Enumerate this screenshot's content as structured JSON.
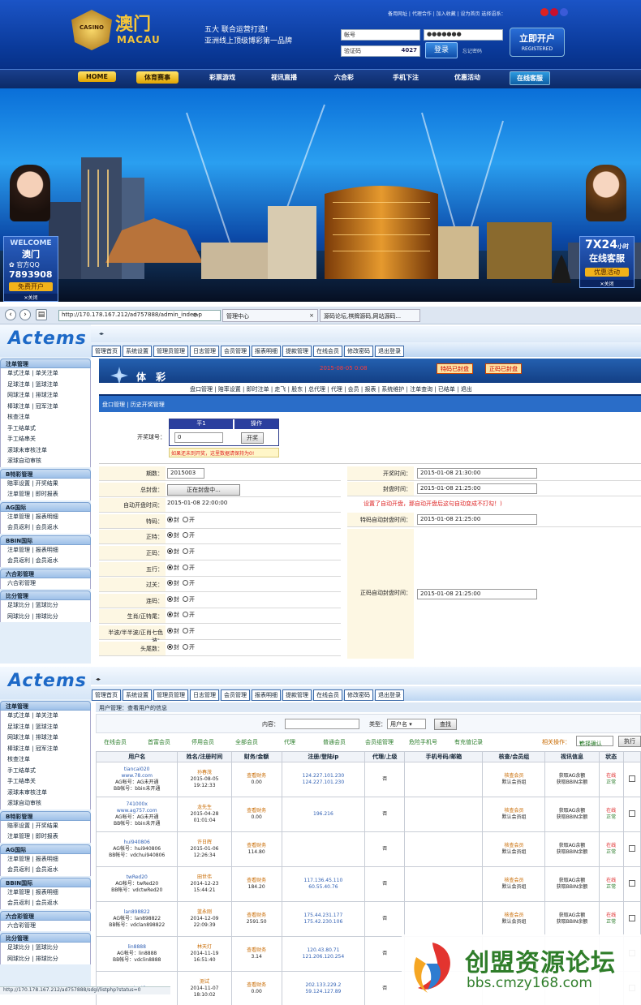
{
  "site": {
    "logo_cn": "澳门",
    "logo_en": "MACAU",
    "crest_text": "CASINO",
    "slogan_line1": "五大  联合运营打造!",
    "slogan_line2": "亚洲线上顶级博彩第一品牌",
    "top_links": "备用网址 | 代理合作 | 加入收藏 | 设为首页  选择语系：",
    "account_label": "帐号",
    "password_label": "密码",
    "password_value": "●●●●●●●",
    "captcha_label": "验证码",
    "captcha_value": "4027",
    "login_button": "登录",
    "forgot": "忘记密码",
    "register_main": "立即开户",
    "register_sub": "REGISTERED",
    "nav": [
      "HOME",
      "体育赛事",
      "彩票游戏",
      "视讯直播",
      "六合彩",
      "手机下注",
      "优惠活动",
      "在线客服"
    ],
    "welcome": {
      "title": "WELCOME",
      "name": "澳门",
      "qq_label": "官方QQ",
      "qq": "7893908",
      "cta": "免费开户",
      "close": "关闭"
    },
    "service": {
      "big": "7X24",
      "small": "小时",
      "label": "在线客服",
      "cta": "优惠活动",
      "close": "关闭"
    }
  },
  "browser": {
    "url": "http://170.178.167.212/ad757888/admin_index.p",
    "tab1": "管理中心",
    "tab2": "源码论坛,棋牌源码,网站源码..."
  },
  "admin": {
    "logo": "Actems",
    "top_nav": [
      "管理首页",
      "系统设置",
      "管理员管理",
      "日志管理",
      "会员管理",
      "报表明细",
      "提款管理",
      "在线会员",
      "修改密码",
      "退出登录"
    ],
    "sidebar_groups": [
      {
        "title": "注单管理",
        "links": [
          "单式注单 | 单关注单",
          "足球注单 | 篮球注单",
          "网球注单 | 排球注单",
          "棒球注单 | 冠军注单",
          "核查注单",
          "手工结单式",
          "手工结串关",
          "滚球未审核注单",
          "滚球自动审核"
        ]
      },
      {
        "title": "B特彩管理",
        "links": [
          "赔率设置 | 开奖结果",
          "注单管理 | 即时报表"
        ]
      },
      {
        "title": "AG国际",
        "links": [
          "注单管理 | 报表明细",
          "会员返利 | 会员返水"
        ]
      },
      {
        "title": "BBIN国际",
        "links": [
          "注单管理 | 报表明细",
          "会员返利 | 会员返水"
        ]
      },
      {
        "title": "六合彩管理",
        "links": [
          "六合彩管理"
        ]
      },
      {
        "title": "比分管理",
        "links": [
          "足球比分 | 篮球比分",
          "网球比分 | 排球比分"
        ]
      }
    ],
    "lottery_title": "体 彩",
    "server_time": "2015-08-05 0:08",
    "btn_special_closed": "特码已封盘",
    "btn_main_closed": "正码已封盘",
    "submenu": "盘口管理 | 赔率设置 | 即时注单 | 走飞 | 股东 | 总代理 | 代理 | 会员 | 报表 | 系统维护 | 注单查询 | 已结单 | 退出",
    "breadcrumb": "盘口管理  |  历史开奖管理",
    "draw_label": "开奖球号：",
    "draw_col1": "平1",
    "draw_col2": "操作",
    "draw_value": "0",
    "draw_button": "开奖",
    "draw_warning": "如果还未到开奖，这里数据请保持为0!",
    "issue_label": "期数：",
    "issue_value": "2015003",
    "draw_time_label": "开奖时间：",
    "draw_time_value": "2015-01-08 21:30:00",
    "total_close_label": "总封盘：",
    "total_close_btn": "正在封盘中...",
    "close_time_label": "封盘时间：",
    "close_time_value": "2015-01-08 21:25:00",
    "auto_open_label": "自动开盘时间：",
    "auto_open_value": "2015-01-08 22:00:00",
    "auto_note": "设置了自动开盘，那自动开盘后这句自动变成不打勾！)",
    "special_auto_label": "特码自动封盘时间：",
    "special_auto_value": "2015-01-08 21:25:00",
    "main_auto_label": "正码自动封盘时间：",
    "main_auto_value": "2015-01-08 21:25:00",
    "opt_close": "封",
    "opt_open": "开",
    "toggles": [
      "特码：",
      "正特：",
      "正码：",
      "五行：",
      "过关：",
      "连码：",
      "生肖/正特尾：",
      "半波/半半波/正肖七色波：",
      "头尾数："
    ]
  },
  "users": {
    "breadcrumb": "用户管理：查看用户的信息",
    "content_label": "内容：",
    "type_label": "类型：",
    "type_value": "用户名",
    "search_btn": "查找",
    "filters": [
      "在线会员",
      "首富会员",
      "停用会员",
      "全部会员",
      "代理",
      "普通会员",
      "会员组管理",
      "危险手机号",
      "有充值记录"
    ],
    "batch_label": "相关操作：",
    "batch_value": "选择确认",
    "exec_btn": "执行",
    "headers": [
      "用户名",
      "姓名/注册时间",
      "财务/金额",
      "注册/登陆ip",
      "代理/上级",
      "手机号码/邮箱",
      "核查/会员组",
      "视讯信息",
      "状态",
      ""
    ],
    "rows": [
      {
        "user": "tiancai020",
        "site": "www.78.com",
        "ag": "AG帐号：AG未开通",
        "bb": "BB帐号：bbin未开通",
        "name": "孙春茂",
        "date": "2015-08-05",
        "time": "19:12:33",
        "fin": "查看财务",
        "amt": "0.00",
        "ip1": "124.227.101.230",
        "ip2": "124.227.101.230",
        "agent": "否",
        "check": "核查会员",
        "group": "默认会员组",
        "v1": "获取AG余额",
        "v2": "获取BBIN余额",
        "online": "在线",
        "state": "正常"
      },
      {
        "user": "741000x",
        "site": "www.ag757.com",
        "ag": "AG帐号：AG未开通",
        "bb": "BB帐号：bbin未开通",
        "name": "龙先生",
        "date": "2015-04-28",
        "time": "01:01:04",
        "fin": "查看财务",
        "amt": "0.00",
        "ip1": "196.216",
        "ip2": "",
        "agent": "否",
        "check": "核查会员",
        "group": "默认会员组",
        "v1": "获取AG余额",
        "v2": "获取BBIN余额",
        "online": "在线",
        "state": "正常"
      },
      {
        "user": "hui940806",
        "site": "",
        "ag": "AG帐号：hui940806",
        "bb": "BB帐号：vdchui940806",
        "name": "许日辉",
        "date": "2015-01-06",
        "time": "12:26:34",
        "fin": "查看财务",
        "amt": "114.80",
        "ip1": "",
        "ip2": "",
        "agent": "否",
        "check": "核查会员",
        "group": "默认会员组",
        "v1": "获取AG余额",
        "v2": "获取BBIN余额",
        "online": "在线",
        "state": "正常"
      },
      {
        "user": "twRed20",
        "site": "",
        "ag": "AG帐号：twRed20",
        "bb": "BB帐号：vdctwRed20",
        "name": "田世伟",
        "date": "2014-12-23",
        "time": "15:44:21",
        "fin": "查看财务",
        "amt": "184.20",
        "ip1": "117.136.45.110",
        "ip2": "60.55.40.76",
        "agent": "否",
        "check": "核查会员",
        "group": "默认会员组",
        "v1": "获取AG余额",
        "v2": "获取BBIN余额",
        "online": "在线",
        "state": "正常"
      },
      {
        "user": "lan898822",
        "site": "",
        "ag": "AG帐号：lan898822",
        "bb": "BB帐号：vdclan898822",
        "name": "蓝永刚",
        "date": "2014-12-09",
        "time": "22:09:39",
        "fin": "查看财务",
        "amt": "2591.50",
        "ip1": "175.44.231.177",
        "ip2": "175.42.230.106",
        "agent": "否",
        "check": "核查会员",
        "group": "默认会员组",
        "v1": "获取AG余额",
        "v2": "获取BBIN余额",
        "online": "在线",
        "state": "正常"
      },
      {
        "user": "lin8888",
        "site": "",
        "ag": "AG帐号：lin8888",
        "bb": "BB帐号：vdclin8888",
        "name": "林天灯",
        "date": "2014-11-19",
        "time": "16:51:40",
        "fin": "查看财务",
        "amt": "3.14",
        "ip1": "120.43.80.71",
        "ip2": "121.206.120.254",
        "agent": "否",
        "check": "",
        "group": "",
        "v1": "",
        "v2": "",
        "online": "",
        "state": ""
      },
      {
        "user": "agtest1",
        "site": "",
        "ag": "",
        "bb": "",
        "name": "测试",
        "date": "2014-11-07",
        "time": "18:10:02",
        "fin": "查看财务",
        "amt": "0.00",
        "ip1": "202.133.229.2",
        "ip2": "59.124.127.89",
        "agent": "否",
        "check": "",
        "group": "",
        "v1": "",
        "v2": "",
        "online": "",
        "state": ""
      }
    ],
    "status_url": "http://170.178.167.212/ad757888/sdgl/listphp?status=0"
  },
  "watermark": {
    "cn": "创盟资源论坛",
    "url": "bbs.cmzy168.com"
  },
  "colors": {
    "brand_blue": "#0b3f9a",
    "gold": "#f4c53a",
    "admin_header": "#2a6dc8",
    "link_green": "#2a7c2a",
    "alert_red": "#d22"
  }
}
